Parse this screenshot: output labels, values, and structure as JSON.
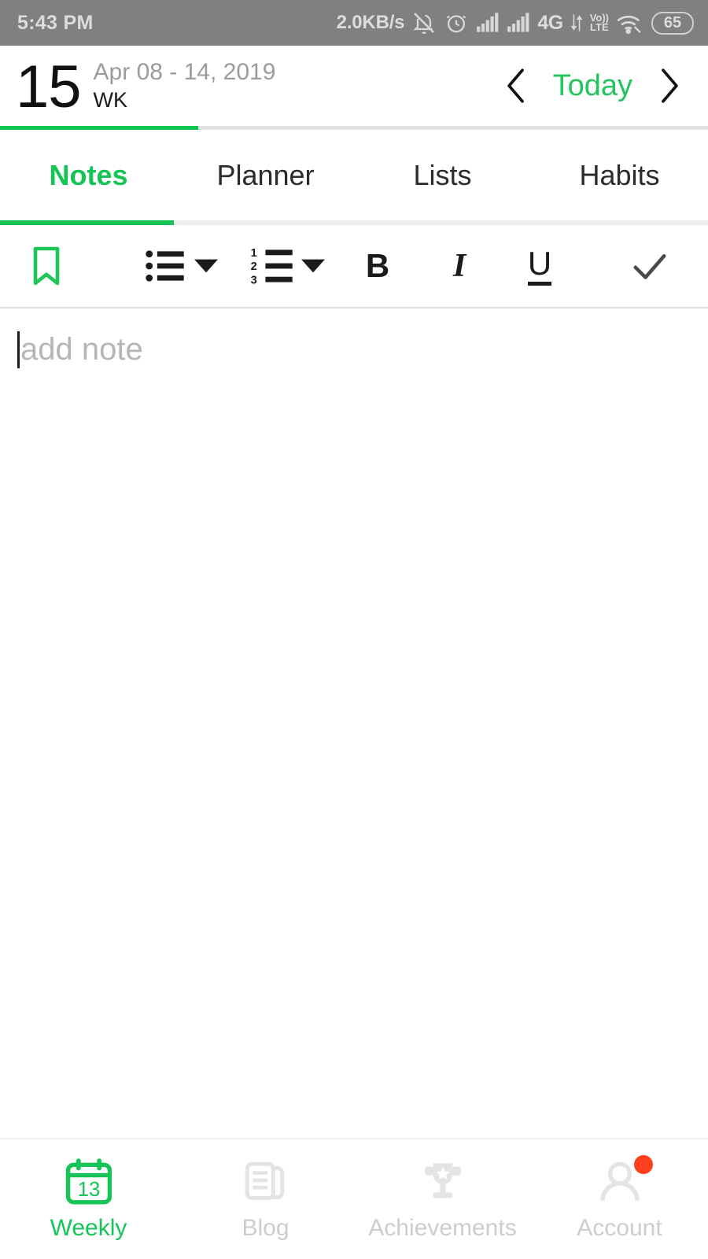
{
  "status_bar": {
    "time": "5:43 PM",
    "data_rate": "2.0KB/s",
    "network": "4G",
    "volte_top": "Vo))",
    "volte_bottom": "LTE",
    "battery": "65",
    "icons": [
      "bell-muted-icon",
      "alarm-icon",
      "signal-icon",
      "signal-icon",
      "volte-icon",
      "wifi-icon",
      "battery-icon"
    ],
    "background": "#808080",
    "foreground": "#d8d8d8"
  },
  "header": {
    "week_number": "15",
    "date_range": "Apr 08 - 14, 2019",
    "week_label": "WK",
    "today_label": "Today",
    "prev_icon": "chevron-left-icon",
    "next_icon": "chevron-right-icon",
    "accent_color": "#22c55e",
    "progress_percent": 28
  },
  "tabs": {
    "items": [
      {
        "label": "Notes",
        "active": true
      },
      {
        "label": "Planner",
        "active": false
      },
      {
        "label": "Lists",
        "active": false
      },
      {
        "label": "Habits",
        "active": false
      }
    ],
    "active_index": 0,
    "active_color": "#14c455"
  },
  "toolbar": {
    "bookmark_icon": "bookmark-icon",
    "bullet_list_icon": "bullet-list-icon",
    "bullet_dropdown_icon": "chevron-down-icon",
    "numbered_list_icon": "numbered-list-icon",
    "numbered_dropdown_icon": "chevron-down-icon",
    "bold_label": "B",
    "italic_label": "I",
    "underline_label": "U",
    "confirm_icon": "check-icon",
    "bookmark_color": "#1ec65a",
    "confirm_color": "#4a4a4a"
  },
  "note_editor": {
    "placeholder": "add note",
    "value": "",
    "caret_visible": true
  },
  "bottom_nav": {
    "items": [
      {
        "label": "Weekly",
        "icon": "calendar-icon",
        "icon_text": "13",
        "active": true,
        "badge": false
      },
      {
        "label": "Blog",
        "icon": "document-icon",
        "icon_text": "",
        "active": false,
        "badge": false
      },
      {
        "label": "Achievements",
        "icon": "trophy-icon",
        "icon_text": "",
        "active": false,
        "badge": false
      },
      {
        "label": "Account",
        "icon": "person-icon",
        "icon_text": "",
        "active": false,
        "badge": true
      }
    ],
    "active_color": "#17c457",
    "inactive_color": "#e4e4e4",
    "badge_color": "#ff3d1f"
  }
}
